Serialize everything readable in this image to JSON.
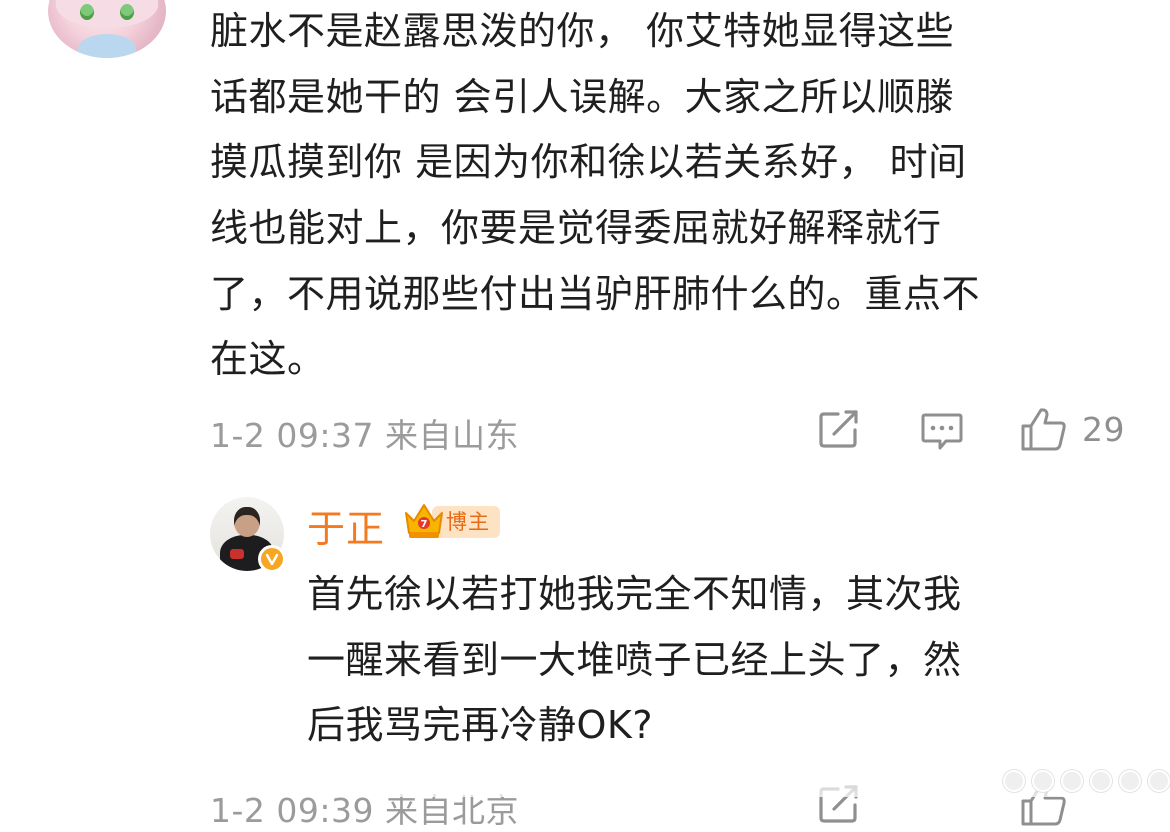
{
  "top_comment": {
    "text": "脏水不是赵露思泼的你， 你艾特她显得这些\n话都是她干的 会引人误解。大家之所以顺滕\n摸瓜摸到你 是因为你和徐以若关系好， 时间\n线也能对上，你要是觉得委屈就好解释就行\n了，不用说那些付出当驴肝肺什么的。重点不\n在这。",
    "timestamp": "1-2 09:37 来自山东",
    "likes": "29"
  },
  "reply": {
    "username": "于正",
    "badge": "博主",
    "text": "首先徐以若打她我完全不知情，其次我\n一醒来看到一大堆喷子已经上头了，然\n后我骂完再冷静OK?",
    "timestamp": "1-2 09:39 来自北京"
  },
  "icons": {
    "share": "share-edit-icon",
    "comment": "comment-bubble-icon",
    "like": "thumbs-up-icon",
    "vip": "vip-crown-icon",
    "verified": "verified-v-icon"
  },
  "colors": {
    "username": "#f47a20",
    "badge_bg": "#fde3c4",
    "badge_text": "#e66b12",
    "meta_text": "#9b9b9b"
  }
}
